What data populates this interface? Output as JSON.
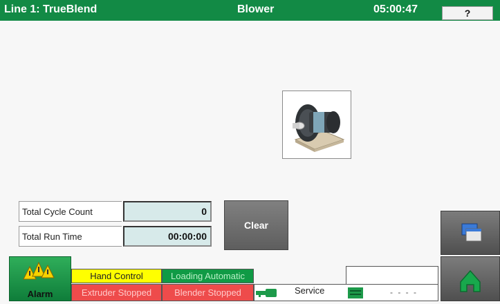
{
  "header": {
    "title": "Line 1: TrueBlend",
    "page": "Blower",
    "time": "05:00:47",
    "help_label": "?"
  },
  "stats": {
    "cycle_label": "Total Cycle Count",
    "cycle_value": "0",
    "runtime_label": "Total Run Time",
    "runtime_value": "00:00:00"
  },
  "clear_label": "Clear",
  "footer": {
    "alarm_label": "Alarm",
    "hand_control": "Hand Control",
    "loading_automatic": "Loading Automatic",
    "extruder_stopped": "Extruder Stopped",
    "blender_stopped": "Blender Stopped",
    "service_label": "Service",
    "dashes": "- - - -"
  },
  "icons": [
    "blower-icon",
    "alarm-warning-icon",
    "window-screens-icon",
    "home-icon",
    "key-icon",
    "document-icon"
  ],
  "colors": {
    "header_green": "#128a45",
    "status_yellow": "#ffff00",
    "status_green": "#109a45",
    "status_red": "#ee4b4b"
  }
}
